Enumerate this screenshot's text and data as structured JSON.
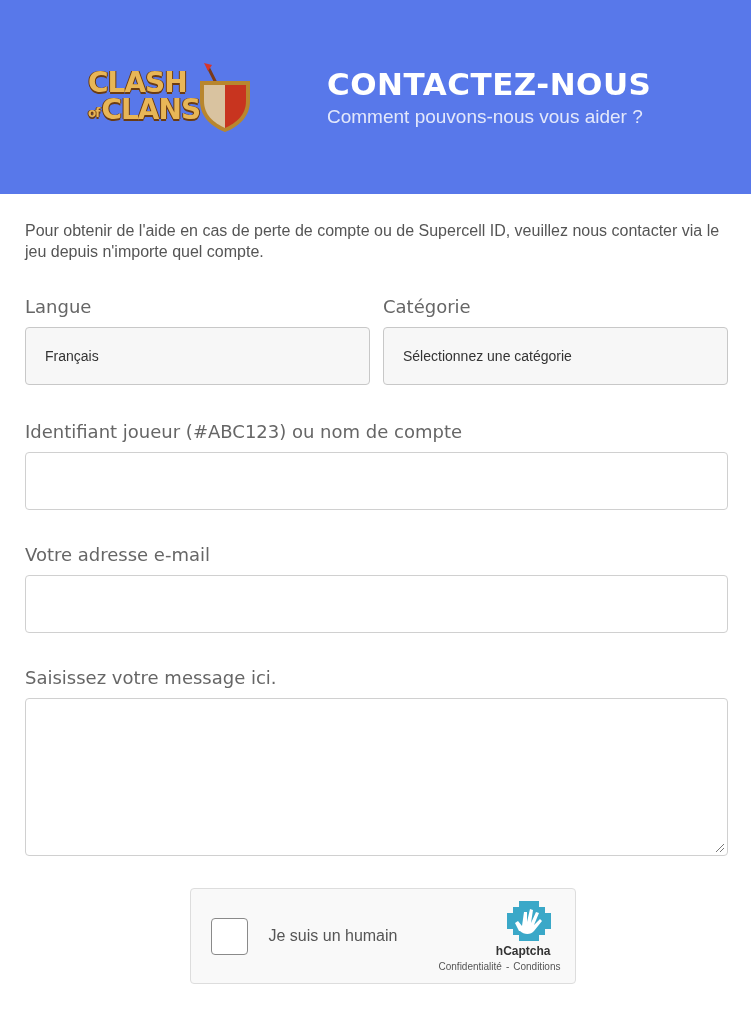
{
  "header": {
    "logo": {
      "top": "CLASH",
      "small": "of",
      "bottom": "CLANS"
    },
    "title": "CONTACTEZ-NOUS",
    "subtitle": "Comment pouvons-nous vous aider ?"
  },
  "intro": "Pour obtenir de l'aide en cas de perte de compte ou de Supercell ID, veuillez nous contacter via le jeu depuis n'importe quel compte.",
  "selects": [
    {
      "label": "Langue",
      "value": "Français"
    },
    {
      "label": "Catégorie",
      "value": "Sélectionnez une catégorie"
    }
  ],
  "fields": [
    {
      "kind": "input",
      "label": "Identifiant joueur (#ABC123) ou nom de compte"
    },
    {
      "kind": "input",
      "label": "Votre adresse e-mail"
    },
    {
      "kind": "textarea",
      "label": "Saisissez votre message ici."
    }
  ],
  "captcha": {
    "checked": false,
    "label": "Je suis un humain",
    "brand": "hCaptcha",
    "privacy": "Confidentialité",
    "separator": "-",
    "terms": "Conditions"
  }
}
